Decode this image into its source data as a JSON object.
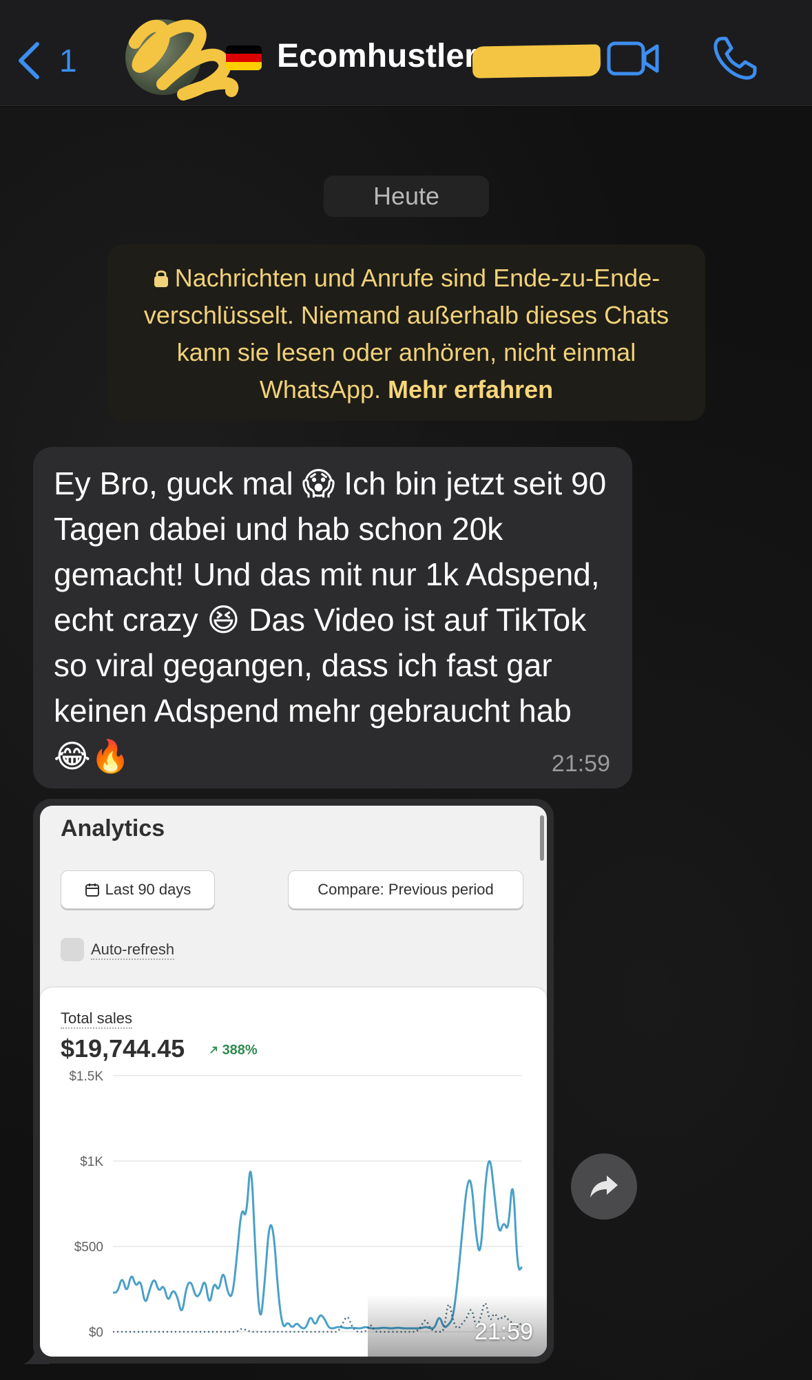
{
  "header": {
    "back_count": "1",
    "contact_name": "Ecomhustler",
    "icons": {
      "back": "chevron-left-icon",
      "video": "video-camera-icon",
      "call": "phone-icon",
      "flag": "german-flag-icon"
    },
    "accent_color": "#3c8ef0"
  },
  "chat": {
    "date_label": "Heute",
    "encryption_notice": {
      "text": "Nachrichten und Anrufe sind Ende-zu-Ende-verschlüsselt. Niemand außerhalb dieses Chats kann sie lesen oder anhören, nicht einmal WhatsApp.",
      "link": "Mehr erfahren",
      "color": "#f1d27a"
    },
    "messages": [
      {
        "text": "Ey Bro, guck mal 😱 Ich bin jetzt seit 90 Tagen dabei und hab schon 20k gemacht! Und das mit nur 1k Adspend, echt crazy 😆 Das Video ist auf TikTok so viral gegangen, dass ich fast gar keinen Adspend mehr gebraucht hab 😂🔥",
        "time": "21:59"
      },
      {
        "type": "image",
        "time": "21:59"
      }
    ]
  },
  "analytics": {
    "title": "Analytics",
    "date_range": "Last 90 days",
    "compare": "Compare: Previous period",
    "auto_refresh": "Auto-refresh",
    "total_sales_label": "Total sales",
    "total_sales_value": "$19,744.45",
    "change": "388%",
    "change_color": "#2f8a4e"
  },
  "chart_data": {
    "type": "line",
    "title": "",
    "xlabel": "",
    "ylabel": "",
    "ylim": [
      0,
      1500
    ],
    "yticks": [
      "$1.5K",
      "$1K",
      "$500",
      "$0"
    ],
    "ytick_values": [
      1500,
      1000,
      500,
      0
    ],
    "grid": true,
    "series": [
      {
        "color": "#4aa0c8",
        "style": "solid",
        "values": [
          230,
          230,
          330,
          220,
          350,
          260,
          310,
          150,
          250,
          320,
          230,
          280,
          170,
          250,
          210,
          90,
          270,
          300,
          200,
          220,
          320,
          140,
          300,
          230,
          370,
          220,
          200,
          450,
          740,
          650,
          1060,
          450,
          20,
          280,
          650,
          590,
          200,
          15,
          60,
          20,
          55,
          20,
          20,
          100,
          30,
          105,
          80,
          20,
          20,
          30,
          25,
          20,
          25,
          20,
          20,
          30,
          20,
          20,
          20,
          25,
          20,
          20,
          25,
          20,
          20,
          20,
          20,
          20,
          30,
          20,
          20,
          100,
          20,
          40,
          80,
          300,
          590,
          870,
          900,
          550,
          430,
          880,
          1050,
          800,
          560,
          650,
          580,
          950,
          350,
          380
        ]
      },
      {
        "color": "#4a6c7e",
        "style": "dotted",
        "values": [
          0,
          0,
          0,
          0,
          0,
          0,
          0,
          0,
          0,
          0,
          0,
          0,
          0,
          0,
          0,
          0,
          0,
          0,
          0,
          0,
          0,
          0,
          0,
          0,
          0,
          0,
          0,
          0,
          20,
          10,
          0,
          0,
          0,
          0,
          0,
          0,
          0,
          0,
          0,
          0,
          0,
          0,
          0,
          0,
          0,
          0,
          0,
          0,
          0,
          0,
          50,
          100,
          30,
          0,
          0,
          0,
          50,
          0,
          0,
          0,
          0,
          0,
          0,
          0,
          0,
          0,
          0,
          30,
          80,
          20,
          0,
          0,
          0,
          200,
          60,
          10,
          50,
          80,
          150,
          20,
          80,
          200,
          50,
          120,
          60,
          100,
          70,
          50,
          20,
          60
        ]
      }
    ]
  }
}
